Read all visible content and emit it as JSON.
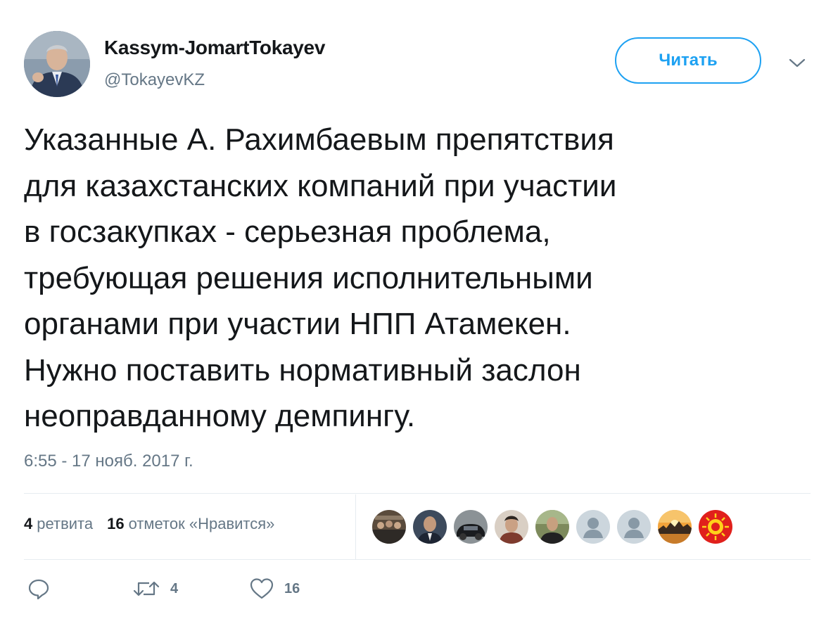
{
  "author": {
    "display_name": "Kassym-JomartTokayev",
    "handle": "@TokayevKZ",
    "avatar_icon": "user-portrait"
  },
  "follow_button": {
    "label": "Читать"
  },
  "menu": {
    "icon": "chevron-down-icon"
  },
  "tweet": {
    "lines": [
      "Указанные А. Рахимбаевым препятствия",
      "для казахстанских компаний при участии",
      "в госзакупках - серьезная проблема,",
      "требующая решения исполнительными",
      "органами при участии НПП Атамекен.",
      "Нужно поставить нормативный заслон",
      "неоправданному демпингу."
    ],
    "timestamp": "6:55 - 17 нояб. 2017 г."
  },
  "stats": {
    "retweets_count": "4",
    "retweets_label": "ретвита",
    "likes_count": "16",
    "likes_label": "отметок «Нравится»"
  },
  "likers": [
    {
      "name": "liker-avatar-1",
      "kind": "photo-group"
    },
    {
      "name": "liker-avatar-2",
      "kind": "photo-person"
    },
    {
      "name": "liker-avatar-3",
      "kind": "photo-car"
    },
    {
      "name": "liker-avatar-4",
      "kind": "photo-person"
    },
    {
      "name": "liker-avatar-5",
      "kind": "photo-person"
    },
    {
      "name": "liker-avatar-6",
      "kind": "default-egg"
    },
    {
      "name": "liker-avatar-7",
      "kind": "default-egg"
    },
    {
      "name": "liker-avatar-8",
      "kind": "photo-sunset"
    },
    {
      "name": "liker-avatar-9",
      "kind": "logo-red-sun"
    }
  ],
  "actions": {
    "reply_icon": "reply-icon",
    "retweet_icon": "retweet-icon",
    "retweet_count": "4",
    "like_icon": "heart-icon",
    "like_count": "16"
  },
  "colors": {
    "accent": "#1da1f2",
    "secondary_text": "#657786",
    "divider": "#e6ecf0"
  }
}
